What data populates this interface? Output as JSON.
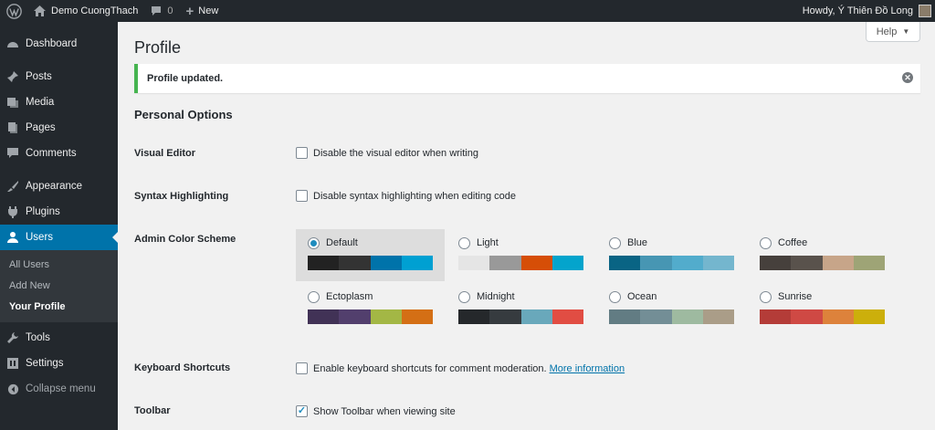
{
  "adminbar": {
    "site_name": "Demo CuongThach",
    "comment_count": "0",
    "new_label": "New",
    "howdy": "Howdy, Ý Thiên Đồ Long"
  },
  "sidebar": {
    "items": [
      {
        "label": "Dashboard",
        "icon": "dashboard-icon"
      },
      {
        "label": "Posts",
        "icon": "pin-icon"
      },
      {
        "label": "Media",
        "icon": "media-icon"
      },
      {
        "label": "Pages",
        "icon": "pages-icon"
      },
      {
        "label": "Comments",
        "icon": "comment-icon"
      },
      {
        "label": "Appearance",
        "icon": "brush-icon"
      },
      {
        "label": "Plugins",
        "icon": "plugin-icon"
      },
      {
        "label": "Users",
        "icon": "user-icon"
      },
      {
        "label": "Tools",
        "icon": "wrench-icon"
      },
      {
        "label": "Settings",
        "icon": "settings-icon"
      }
    ],
    "users_sub": [
      "All Users",
      "Add New",
      "Your Profile"
    ],
    "collapse_label": "Collapse menu"
  },
  "help_label": "Help",
  "page_title": "Profile",
  "notice": "Profile updated.",
  "section_title": "Personal Options",
  "rows": {
    "visual_editor": {
      "label": "Visual Editor",
      "text": "Disable the visual editor when writing",
      "checked": false
    },
    "syntax": {
      "label": "Syntax Highlighting",
      "text": "Disable syntax highlighting when editing code",
      "checked": false
    },
    "color_scheme": {
      "label": "Admin Color Scheme"
    },
    "shortcuts": {
      "label": "Keyboard Shortcuts",
      "text": "Enable keyboard shortcuts for comment moderation.",
      "link": "More information",
      "checked": false
    },
    "toolbar": {
      "label": "Toolbar",
      "text": "Show Toolbar when viewing site",
      "checked": true
    }
  },
  "color_schemes": [
    {
      "name": "Default",
      "selected": true,
      "colors": [
        "#222222",
        "#333333",
        "#0073aa",
        "#00a0d2"
      ]
    },
    {
      "name": "Light",
      "selected": false,
      "colors": [
        "#e5e5e5",
        "#999999",
        "#d64e07",
        "#04a4cc"
      ]
    },
    {
      "name": "Blue",
      "selected": false,
      "colors": [
        "#096484",
        "#4796b3",
        "#52accc",
        "#74b6ce"
      ]
    },
    {
      "name": "Coffee",
      "selected": false,
      "colors": [
        "#46403c",
        "#59524c",
        "#c7a589",
        "#9ea476"
      ]
    },
    {
      "name": "Ectoplasm",
      "selected": false,
      "colors": [
        "#413256",
        "#523f6d",
        "#a3b745",
        "#d46f15"
      ]
    },
    {
      "name": "Midnight",
      "selected": false,
      "colors": [
        "#25282b",
        "#363b3f",
        "#69a8bb",
        "#e14d43"
      ]
    },
    {
      "name": "Ocean",
      "selected": false,
      "colors": [
        "#627c83",
        "#738e96",
        "#9ebaa0",
        "#aa9d88"
      ]
    },
    {
      "name": "Sunrise",
      "selected": false,
      "colors": [
        "#b43c38",
        "#cf4944",
        "#dd823b",
        "#ccaf0b"
      ]
    }
  ]
}
